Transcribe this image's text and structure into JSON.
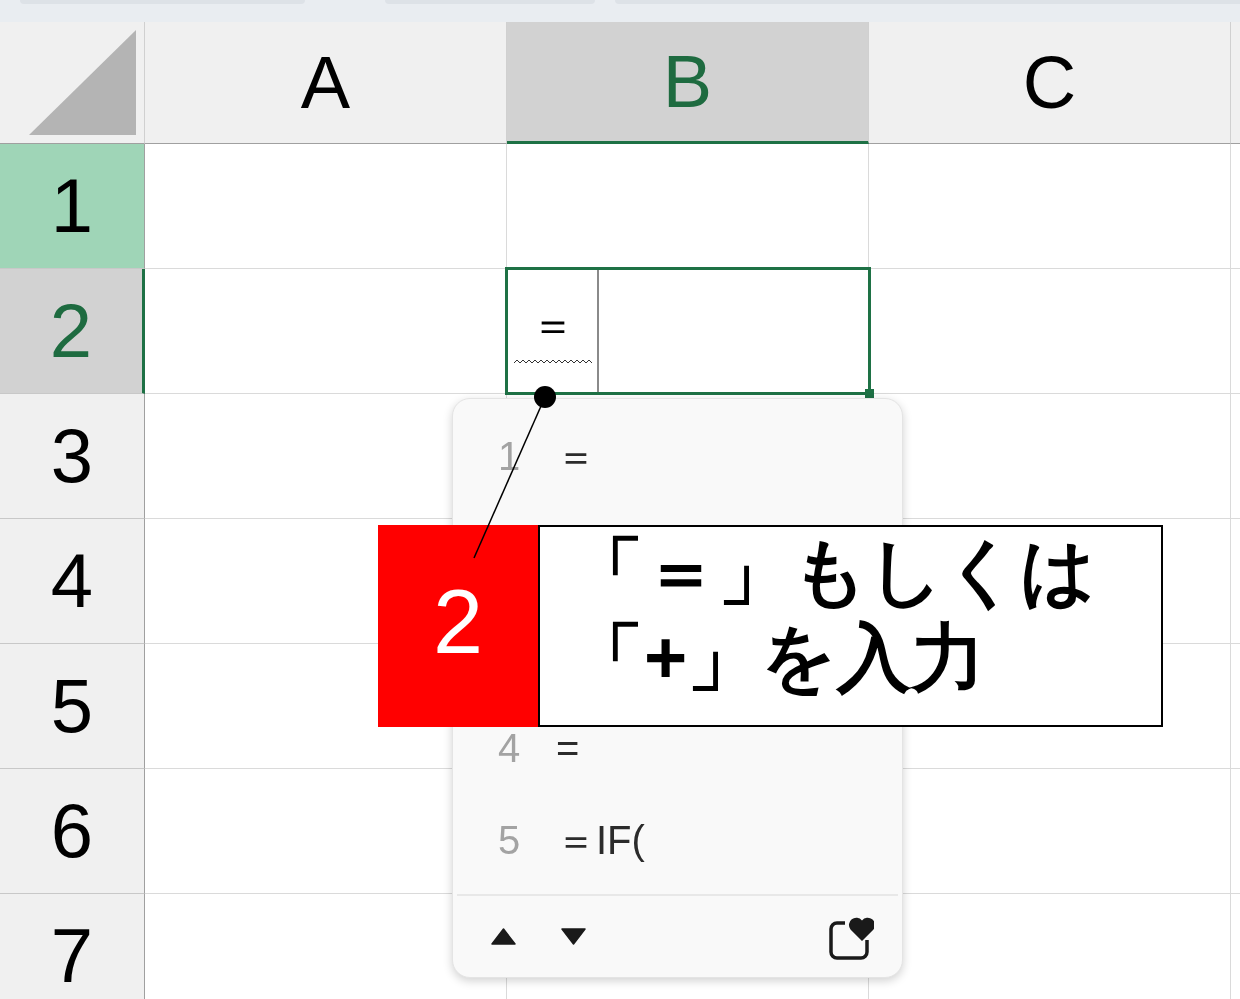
{
  "columns": [
    {
      "label": "A",
      "selected": false
    },
    {
      "label": "B",
      "selected": true
    },
    {
      "label": "C",
      "selected": false
    }
  ],
  "rows": [
    {
      "label": "1",
      "selected": false,
      "highlighted": true
    },
    {
      "label": "2",
      "selected": true,
      "highlighted": false
    },
    {
      "label": "3",
      "selected": false,
      "highlighted": false
    },
    {
      "label": "4",
      "selected": false,
      "highlighted": false
    },
    {
      "label": "5",
      "selected": false,
      "highlighted": false
    },
    {
      "label": "6",
      "selected": false,
      "highlighted": false
    },
    {
      "label": "7",
      "selected": false,
      "highlighted": false
    }
  ],
  "active_cell": {
    "value": "＝",
    "composing": true
  },
  "candidate_window": {
    "items": [
      {
        "number": "1",
        "text": "＝"
      },
      {
        "number": "4",
        "text": "="
      },
      {
        "number": "5",
        "text": "＝IF("
      }
    ]
  },
  "callout": {
    "step": "2",
    "lines": [
      "「＝」もしくは",
      "「+」を入力"
    ]
  }
}
